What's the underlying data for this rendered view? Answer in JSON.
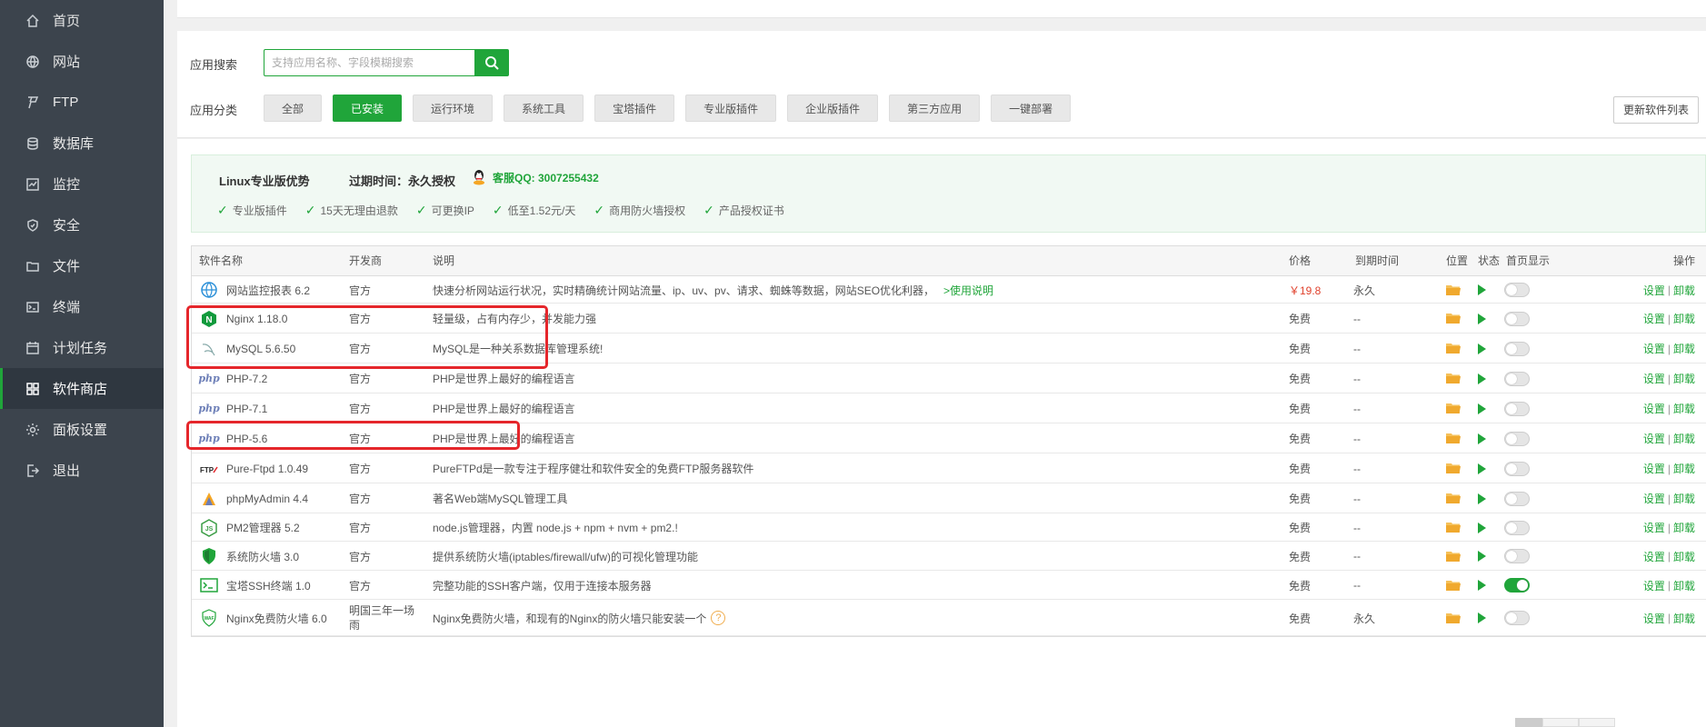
{
  "sidebar": {
    "items": [
      {
        "label": "首页",
        "icon": "home-icon"
      },
      {
        "label": "网站",
        "icon": "globe-icon"
      },
      {
        "label": "FTP",
        "icon": "ftp-icon"
      },
      {
        "label": "数据库",
        "icon": "database-icon"
      },
      {
        "label": "监控",
        "icon": "monitor-icon"
      },
      {
        "label": "安全",
        "icon": "shield-icon"
      },
      {
        "label": "文件",
        "icon": "folder-icon"
      },
      {
        "label": "终端",
        "icon": "terminal-icon"
      },
      {
        "label": "计划任务",
        "icon": "calendar-icon"
      },
      {
        "label": "软件商店",
        "icon": "grid-icon",
        "active": true
      },
      {
        "label": "面板设置",
        "icon": "gear-icon"
      },
      {
        "label": "退出",
        "icon": "logout-icon"
      }
    ]
  },
  "search": {
    "label": "应用搜索",
    "placeholder": "支持应用名称、字段模糊搜索"
  },
  "categories": {
    "label": "应用分类",
    "items": [
      "全部",
      "已安装",
      "运行环境",
      "系统工具",
      "宝塔插件",
      "专业版插件",
      "企业版插件",
      "第三方应用",
      "一键部署"
    ],
    "active": "已安装"
  },
  "refresh_label": "更新软件列表",
  "pro": {
    "title": "Linux专业版优势",
    "expire": "过期时间：永久授权",
    "qq": "客服QQ: 3007255432",
    "perks": [
      "专业版插件",
      "15天无理由退款",
      "可更换IP",
      "低至1.52元/天",
      "商用防火墙授权",
      "产品授权证书"
    ]
  },
  "table": {
    "headers": {
      "name": "软件名称",
      "dev": "开发商",
      "desc": "说明",
      "price": "价格",
      "expire": "到期时间",
      "pos": "位置",
      "state": "状态",
      "home": "首页显示",
      "op": "操作"
    },
    "op_settings": "设置",
    "op_uninstall": "卸载",
    "help_link": ">使用说明",
    "rows": [
      {
        "name": "网站监控报表 6.2",
        "dev": "官方",
        "desc": "快速分析网站运行状况，实时精确统计网站流量、ip、uv、pv、请求、蜘蛛等数据，网站SEO优化利器，",
        "price": "￥19.8",
        "expire": "永久",
        "icon": "web-monitor-icon",
        "home_on": false,
        "help": true
      },
      {
        "name": "Nginx 1.18.0",
        "dev": "官方",
        "desc": "轻量级，占有内存少，并发能力强",
        "price": "免费",
        "expire": "--",
        "icon": "nginx-icon",
        "home_on": false
      },
      {
        "name": "MySQL 5.6.50",
        "dev": "官方",
        "desc": "MySQL是一种关系数据库管理系统!",
        "price": "免费",
        "expire": "--",
        "icon": "mysql-icon",
        "home_on": false
      },
      {
        "name": "PHP-7.2",
        "dev": "官方",
        "desc": "PHP是世界上最好的编程语言",
        "price": "免费",
        "expire": "--",
        "icon": "php-icon",
        "home_on": false
      },
      {
        "name": "PHP-7.1",
        "dev": "官方",
        "desc": "PHP是世界上最好的编程语言",
        "price": "免费",
        "expire": "--",
        "icon": "php-icon",
        "home_on": false
      },
      {
        "name": "PHP-5.6",
        "dev": "官方",
        "desc": "PHP是世界上最好的编程语言",
        "price": "免费",
        "expire": "--",
        "icon": "php-icon",
        "home_on": false
      },
      {
        "name": "Pure-Ftpd 1.0.49",
        "dev": "官方",
        "desc": "PureFTPd是一款专注于程序健壮和软件安全的免费FTP服务器软件",
        "price": "免费",
        "expire": "--",
        "icon": "ftp-logo-icon",
        "home_on": false
      },
      {
        "name": "phpMyAdmin 4.4",
        "dev": "官方",
        "desc": "著名Web端MySQL管理工具",
        "price": "免费",
        "expire": "--",
        "icon": "phpmyadmin-icon",
        "home_on": false
      },
      {
        "name": "PM2管理器 5.2",
        "dev": "官方",
        "desc": "node.js管理器，内置 node.js + npm + nvm + pm2.!",
        "price": "免费",
        "expire": "--",
        "icon": "nodejs-icon",
        "home_on": false
      },
      {
        "name": "系统防火墙 3.0",
        "dev": "官方",
        "desc": "提供系统防火墙(iptables/firewall/ufw)的可视化管理功能",
        "price": "免费",
        "expire": "--",
        "icon": "firewall-icon",
        "home_on": false
      },
      {
        "name": "宝塔SSH终端 1.0",
        "dev": "官方",
        "desc": "完整功能的SSH客户端，仅用于连接本服务器",
        "price": "免费",
        "expire": "--",
        "icon": "ssh-terminal-icon",
        "home_on": true
      },
      {
        "name": "Nginx免费防火墙 6.0",
        "dev": "明国三年一场雨",
        "desc": "Nginx免费防火墙，和现有的Nginx的防火墙只能安装一个",
        "price": "免费",
        "expire": "永久",
        "icon": "waf-icon",
        "home_on": false,
        "question": true
      }
    ]
  },
  "colors": {
    "accent": "#20a53a",
    "sidebar_bg": "#3c444d",
    "highlight": "#e5262b"
  }
}
